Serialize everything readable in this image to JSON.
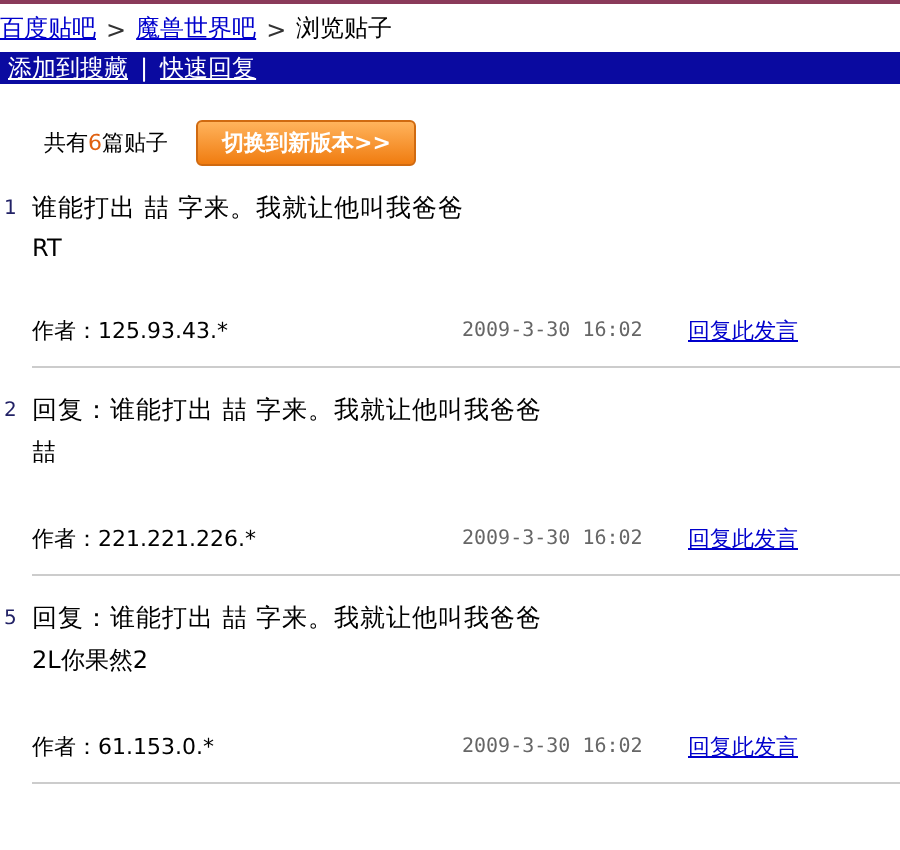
{
  "breadcrumb": [
    {
      "label": "百度贴吧",
      "link": true
    },
    {
      "label": "魔兽世界吧",
      "link": true
    },
    {
      "label": "浏览贴子",
      "link": false
    }
  ],
  "breadcrumb_separator": ">",
  "nav_bar": {
    "links": [
      "添加到搜藏",
      "快速回复"
    ],
    "separator": "|"
  },
  "summary": {
    "prefix": "共有",
    "count": "6",
    "suffix": "篇贴子",
    "button": "切换到新版本>>"
  },
  "posts": [
    {
      "floor": "1",
      "title": "谁能打出 喆 字来。我就让他叫我爸爸",
      "body": "RT",
      "author": "作者：125.93.43.*",
      "time": "2009-3-30 16:02",
      "reply": "回复此发言"
    },
    {
      "floor": "2",
      "title": "回复：谁能打出 喆 字来。我就让他叫我爸爸",
      "body": "喆",
      "author": "作者：221.221.226.*",
      "time": "2009-3-30 16:02",
      "reply": "回复此发言"
    },
    {
      "floor": "5",
      "title": "回复：谁能打出 喆 字来。我就让他叫我爸爸",
      "body": "2L你果然2",
      "author": "作者：61.153.0.*",
      "time": "2009-3-30 16:02",
      "reply": "回复此发言"
    }
  ]
}
